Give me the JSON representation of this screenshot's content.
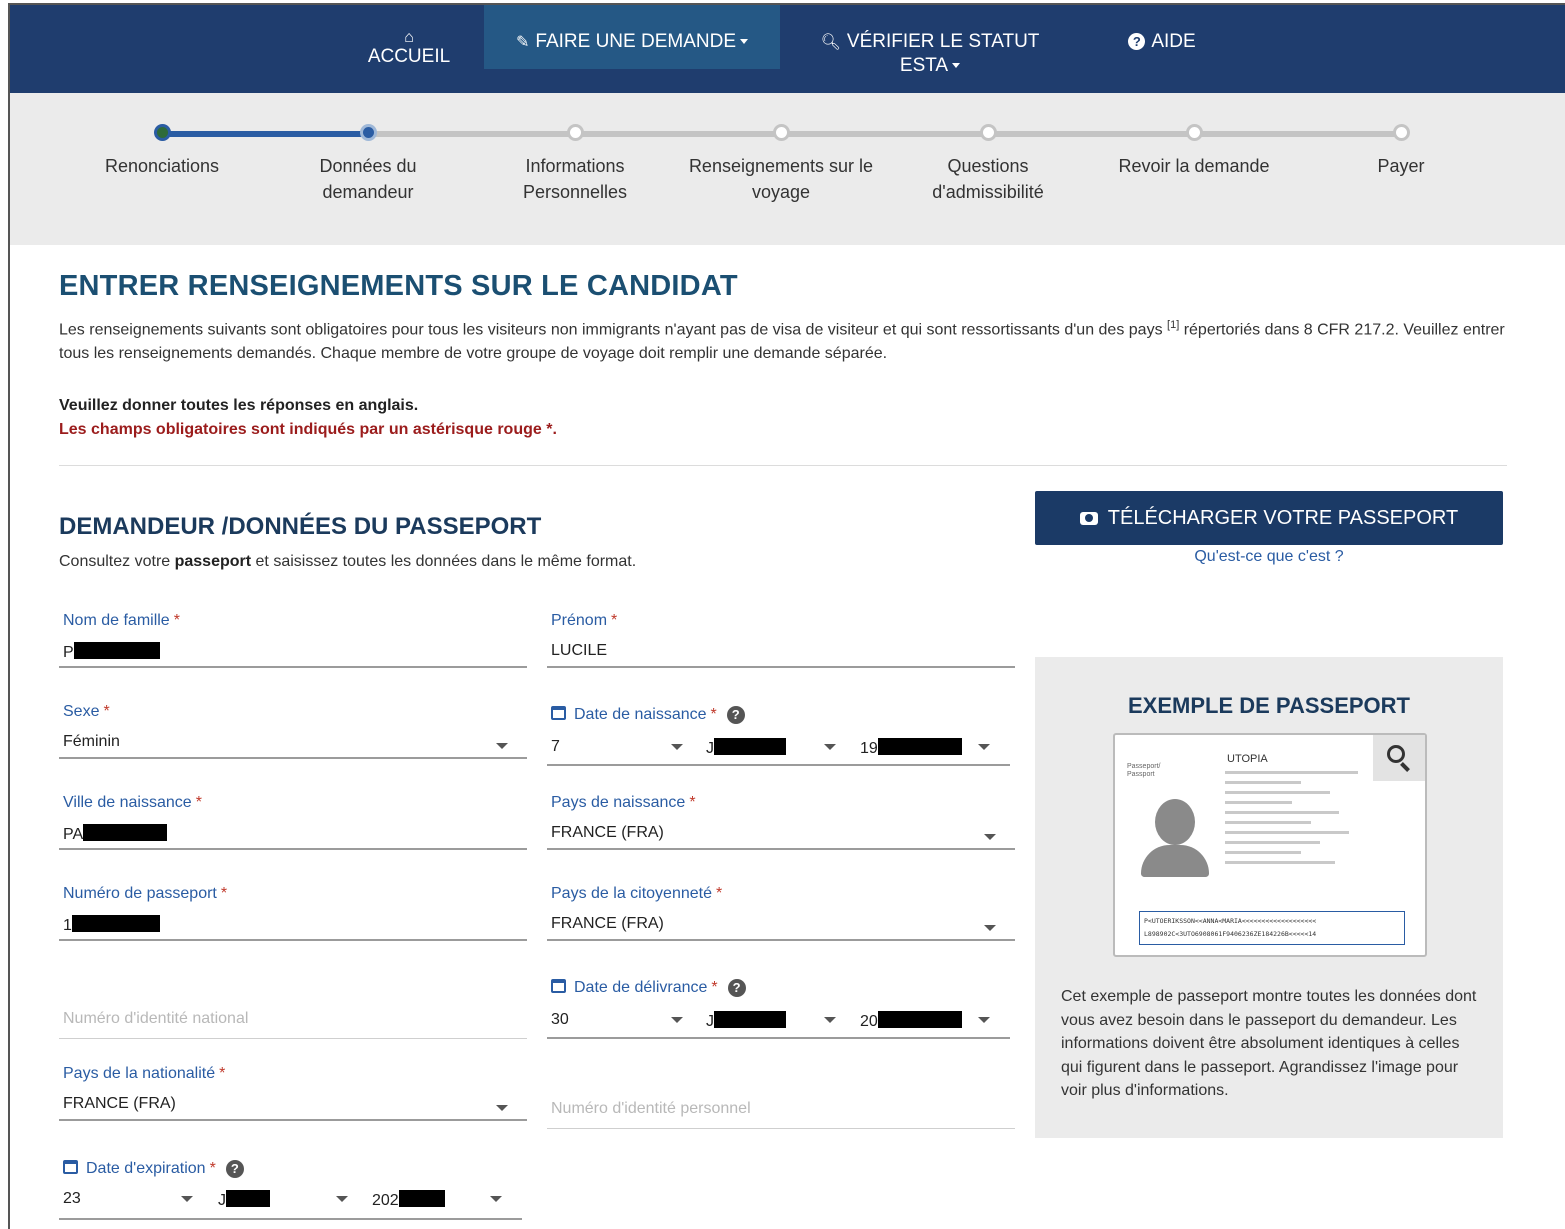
{
  "nav": {
    "home": "ACCUEIL",
    "apply": "FAIRE UNE DEMANDE",
    "status_line1": "VÉRIFIER LE STATUT",
    "status_line2": "ESTA",
    "help": "AIDE"
  },
  "progress": {
    "steps": [
      {
        "line1": "Renonciations",
        "line2": "",
        "state": "done"
      },
      {
        "line1": "Données du",
        "line2": "demandeur",
        "state": "current"
      },
      {
        "line1": "Informations",
        "line2": "Personnelles",
        "state": "todo"
      },
      {
        "line1": "Renseignements sur le",
        "line2": "voyage",
        "state": "todo"
      },
      {
        "line1": "Questions",
        "line2": "d'admissibilité",
        "state": "todo"
      },
      {
        "line1": "Revoir la demande",
        "line2": "",
        "state": "todo"
      },
      {
        "line1": "Payer",
        "line2": "",
        "state": "todo"
      }
    ]
  },
  "main": {
    "title": "ENTRER RENSEIGNEMENTS SUR LE CANDIDAT",
    "intro_part1": "Les renseignements suivants sont obligatoires pour tous les visiteurs non immigrants n'ayant pas de visa de visiteur et qui sont ressortissants d'un des pays ",
    "intro_sup": "[1]",
    "intro_part2": " répertoriés dans 8 CFR 217.2. Veuillez entrer tous les renseignements demandés. Chaque membre de votre groupe de voyage doit remplir une demande séparée.",
    "answer_note": "Veuillez donner toutes les réponses en anglais.",
    "required_note": "Les champs obligatoires sont indiqués par un astérisque rouge *."
  },
  "section": {
    "title": "DEMANDEUR /DONNÉES DU PASSEPORT",
    "sub_part1": "Consultez votre ",
    "sub_bold": "passeport",
    "sub_part2": " et saisissez toutes les données dans le même format."
  },
  "form": {
    "required_mark": "*",
    "last_name": {
      "label": "Nom de famille",
      "value_visible": "P"
    },
    "first_name": {
      "label": "Prénom",
      "value": "LUCILE"
    },
    "sex": {
      "label": "Sexe",
      "value": "Féminin"
    },
    "birth_date": {
      "label": "Date de naissance",
      "day": "7",
      "month_visible": "J",
      "year_visible": "19"
    },
    "birth_city": {
      "label": "Ville de naissance",
      "value_visible": "PA"
    },
    "birth_country": {
      "label": "Pays de naissance",
      "value": "FRANCE (FRA)"
    },
    "passport_number": {
      "label": "Numéro de passeport",
      "value_visible": "1"
    },
    "citizenship_country": {
      "label": "Pays de la citoyenneté",
      "value": "FRANCE (FRA)"
    },
    "national_id": {
      "placeholder": "Numéro d'identité national"
    },
    "issue_date": {
      "label": "Date de délivrance",
      "day": "30",
      "month_visible": "J",
      "year_visible": "20"
    },
    "nationality_country": {
      "label": "Pays de la nationalité",
      "value": "FRANCE (FRA)"
    },
    "personal_id": {
      "placeholder": "Numéro d'identité personnel"
    },
    "expiry_date": {
      "label": "Date d'expiration",
      "day": "23",
      "month_visible": "J",
      "year_visible": "202"
    }
  },
  "upload": {
    "button": "TÉLÉCHARGER VOTRE PASSEPORT",
    "whatis": "Qu'est-ce que c'est ?"
  },
  "example": {
    "title": "EXEMPLE DE PASSEPORT",
    "country": "UTOPIA",
    "type_label": "Passeport/ Passport",
    "mrz_line1": "P<UTOERIKSSON<<ANNA<MARIA<<<<<<<<<<<<<<<<<<<",
    "mrz_line2": "L898902C<3UTO6908061F9406236ZE184226B<<<<<14",
    "text": "Cet exemple de passeport montre toutes les données dont vous avez besoin dans le passeport du demandeur. Les informations doivent être absolument identiques à celles qui figurent dans le passeport. Agrandissez l'image pour voir plus d'informations."
  },
  "colors": {
    "nav_bg": "#1f3d6e",
    "nav_active": "#255885",
    "label_blue": "#2a5ca3",
    "required_red": "#c0392b",
    "button_bg": "#1b3a66"
  },
  "icons": {
    "home": "home-icon",
    "apply": "pencil-icon",
    "status": "search-icon",
    "help": "question-circle-icon",
    "upload": "camera-icon",
    "calendar": "calendar-icon",
    "zoom": "magnifier-icon"
  }
}
